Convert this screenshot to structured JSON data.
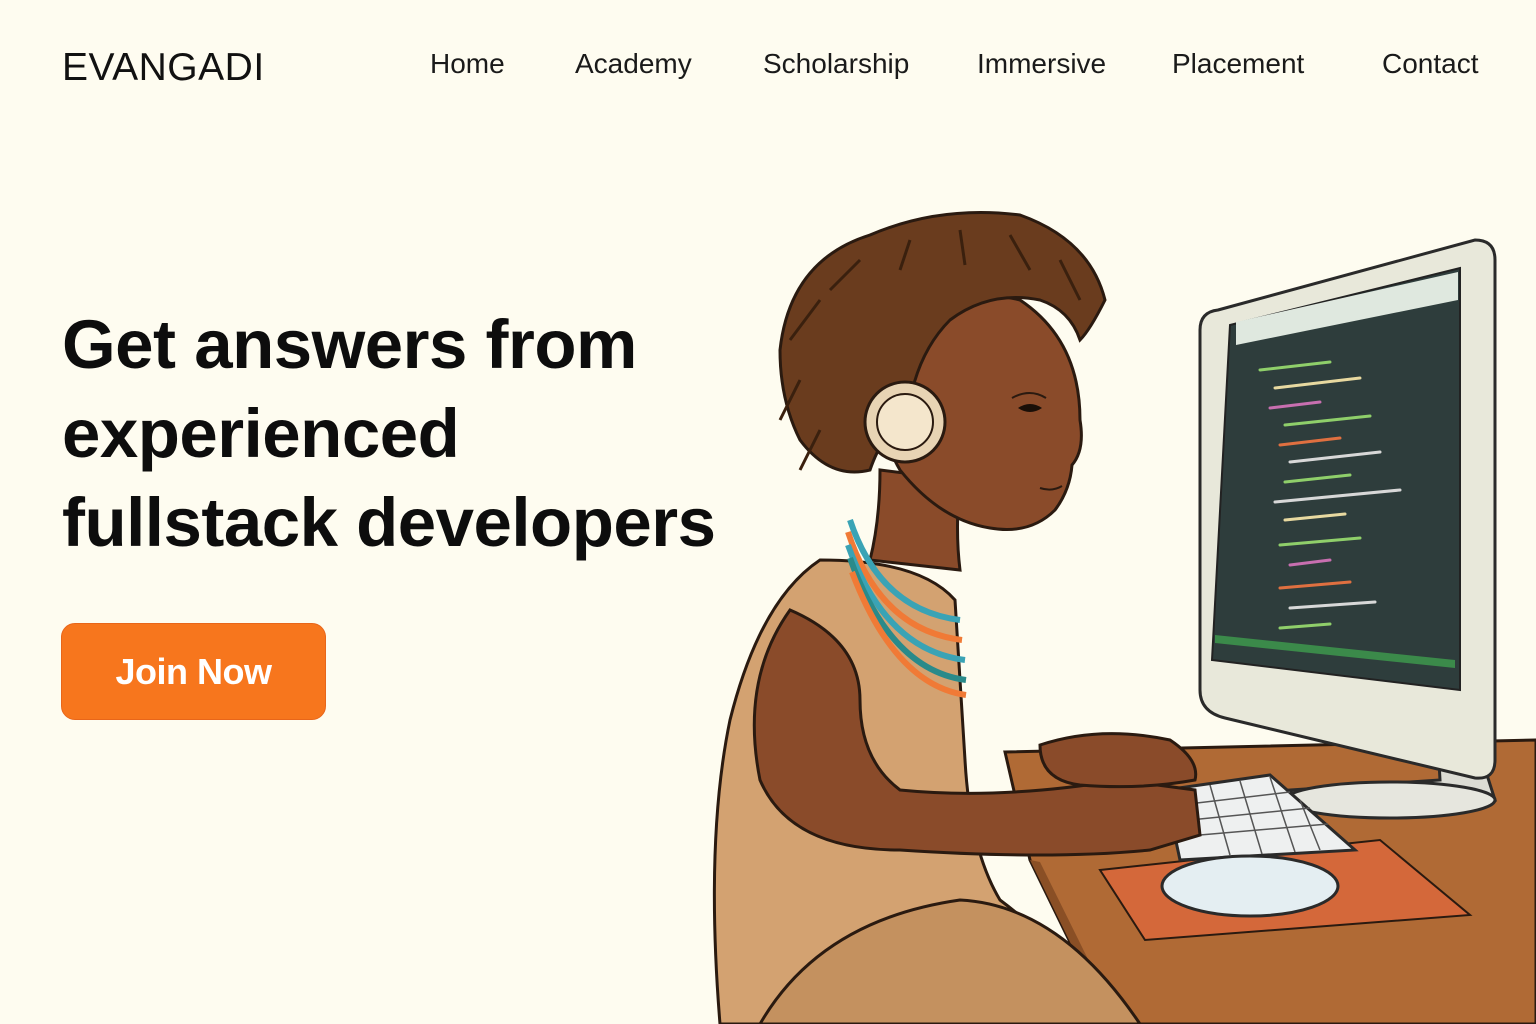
{
  "header": {
    "logo": "EVANGADI",
    "nav": [
      {
        "label": "Home"
      },
      {
        "label": "Academy"
      },
      {
        "label": "Scholarship"
      },
      {
        "label": "Immersive"
      },
      {
        "label": "Placement"
      },
      {
        "label": "Contact"
      }
    ]
  },
  "hero": {
    "title_lines": [
      "Get answers from",
      "experienced",
      "fullstack developers"
    ],
    "cta_label": "Join Now"
  },
  "colors": {
    "background": "#fefcf0",
    "accent": "#f7761d",
    "text": "#111111"
  }
}
